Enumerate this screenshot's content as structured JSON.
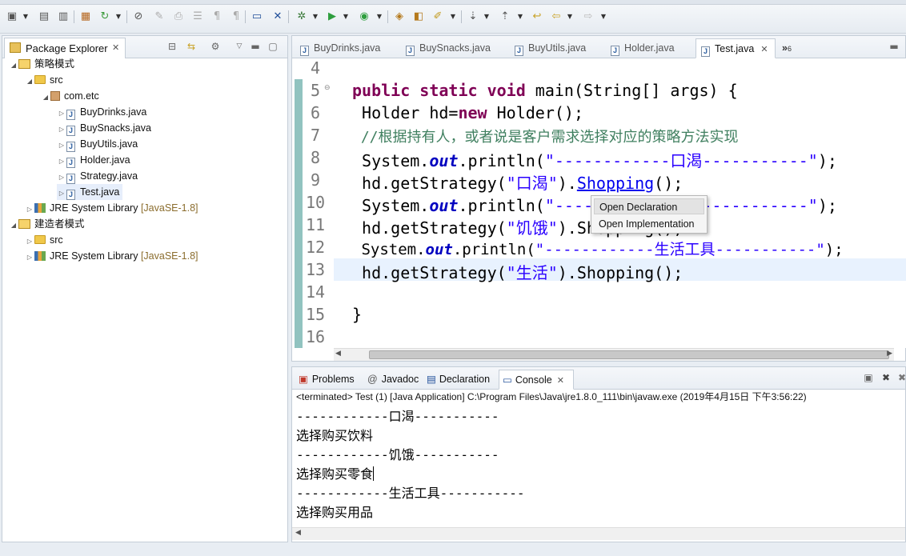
{
  "toolbar": {
    "buttons": [
      "new-icon",
      "save-icon",
      "save-all-icon",
      "package-icon",
      "refresh-icon",
      "skip-breakpoints-icon",
      "remove-icon",
      "print-icon",
      "document-icon",
      "format-icon",
      "console-icon",
      "pin-icon",
      "debug-icon",
      "run-icon",
      "coverage-icon",
      "open-type-icon",
      "open-task-icon",
      "search-icon",
      "next-annotation-icon",
      "prev-annotation-icon",
      "back-icon",
      "forward-icon"
    ]
  },
  "package_explorer": {
    "title": "Package Explorer",
    "tree": [
      {
        "label": "策略模式",
        "suffix": "",
        "level": 0,
        "kind": "project",
        "expanded": true
      },
      {
        "label": "src",
        "suffix": "",
        "level": 1,
        "kind": "folder",
        "expanded": true
      },
      {
        "label": "com.etc",
        "suffix": "",
        "level": 2,
        "kind": "package",
        "expanded": true
      },
      {
        "label": "BuyDrinks.java",
        "suffix": "",
        "level": 3,
        "kind": "java"
      },
      {
        "label": "BuySnacks.java",
        "suffix": "",
        "level": 3,
        "kind": "java"
      },
      {
        "label": "BuyUtils.java",
        "suffix": "",
        "level": 3,
        "kind": "java"
      },
      {
        "label": "Holder.java",
        "suffix": "",
        "level": 3,
        "kind": "java"
      },
      {
        "label": "Strategy.java",
        "suffix": "",
        "level": 3,
        "kind": "java"
      },
      {
        "label": "Test.java",
        "suffix": "",
        "level": 3,
        "kind": "java",
        "selected": true
      },
      {
        "label": "JRE System Library",
        "suffix": "[JavaSE-1.8]",
        "level": 1,
        "kind": "library"
      },
      {
        "label": "建造者模式",
        "suffix": "",
        "level": 0,
        "kind": "project",
        "expanded": true
      },
      {
        "label": "src",
        "suffix": "",
        "level": 1,
        "kind": "folder"
      },
      {
        "label": "JRE System Library",
        "suffix": "[JavaSE-1.8]",
        "level": 1,
        "kind": "library"
      }
    ]
  },
  "editor": {
    "tabs": [
      "BuyDrinks.java",
      "BuySnacks.java",
      "BuyUtils.java",
      "Holder.java",
      "Test.java"
    ],
    "active_tab": "Test.java",
    "overflow_count": "6",
    "line_numbers": [
      "4",
      "5",
      "6",
      "7",
      "8",
      "9",
      "10",
      "11",
      "12",
      "13",
      "14",
      "15",
      "16"
    ],
    "code": {
      "l5_kw": "public static void",
      "l5_rest": " main(String[] args) {",
      "l6_a": " Holder hd=",
      "l6_kw": "new",
      "l6_b": " Holder();",
      "l7_comment": " //根据持有人，或者说是客户需求选择对应的策略方法实现",
      "l8_a": " System.",
      "l8_out": "out",
      "l8_b": ".println(",
      "l8_str": "\"------------口渴-----------\"",
      "l8_c": ");",
      "l9_a": " hd.getStrategy(",
      "l9_str": "\"口渴\"",
      "l9_b": ").",
      "l9_link": "Shopping",
      "l9_c": "();",
      "l10_a": " System.",
      "l10_out": "out",
      "l10_b": ".println(",
      "l10_str": "\"------------饥饿-----------\"",
      "l10_c": ");",
      "l11_a": " hd.getStrategy(",
      "l11_str": "\"饥饿\"",
      "l11_b": ").Shopping();",
      "l12_a": " System.",
      "l12_out": "out",
      "l12_b": ".println(",
      "l12_str": "\"------------生活工具-----------\"",
      "l12_c": ");",
      "l13_a": " hd.getStrategy(",
      "l13_str": "\"生活\"",
      "l13_b": ").Shopping();",
      "l15": "}"
    }
  },
  "context_menu": {
    "items": [
      "Open Declaration",
      "Open Implementation"
    ]
  },
  "console": {
    "tabs": [
      "Problems",
      "Javadoc",
      "Declaration",
      "Console"
    ],
    "active_tab": "Console",
    "status": "<terminated> Test (1) [Java Application] C:\\Program Files\\Java\\jre1.8.0_111\\bin\\javaw.exe (2019年4月15日 下午3:56:22)",
    "output": [
      "------------口渴-----------",
      "选择购买饮料",
      "------------饥饿-----------",
      "选择购买零食",
      "------------生活工具-----------",
      "选择购买用品"
    ]
  }
}
